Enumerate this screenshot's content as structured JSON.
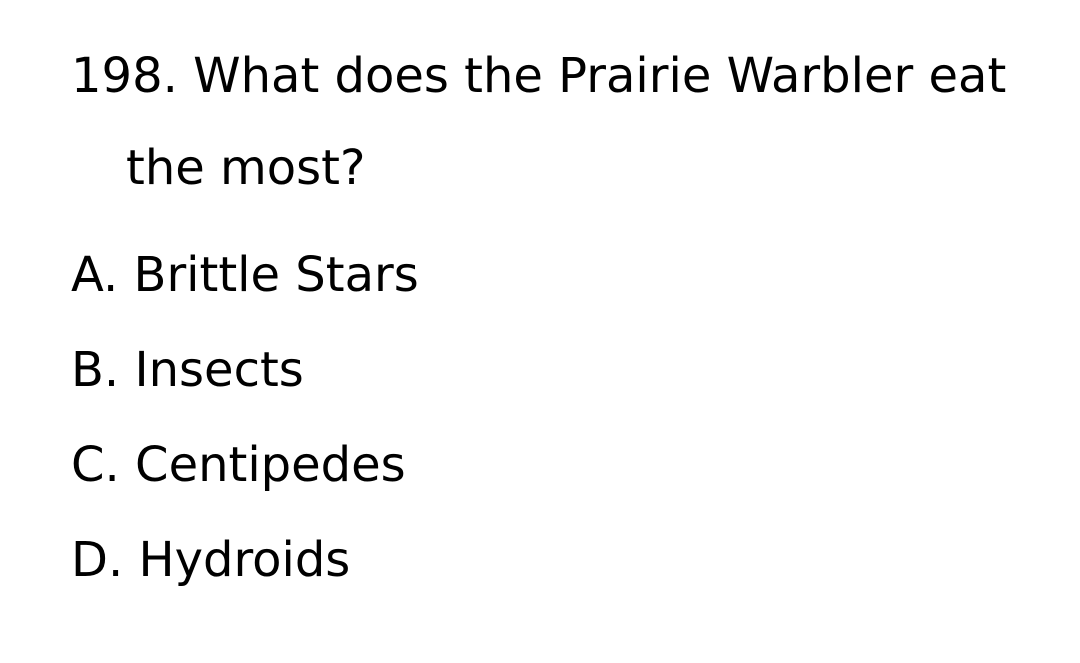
{
  "question": {
    "number": "198.",
    "text": "What does the Prairie Warbler eat the most?"
  },
  "options": [
    {
      "letter": "A.",
      "text": "Brittle Stars"
    },
    {
      "letter": "B.",
      "text": "Insects"
    },
    {
      "letter": "C.",
      "text": "Centipedes"
    },
    {
      "letter": "D.",
      "text": "Hydroids"
    }
  ]
}
